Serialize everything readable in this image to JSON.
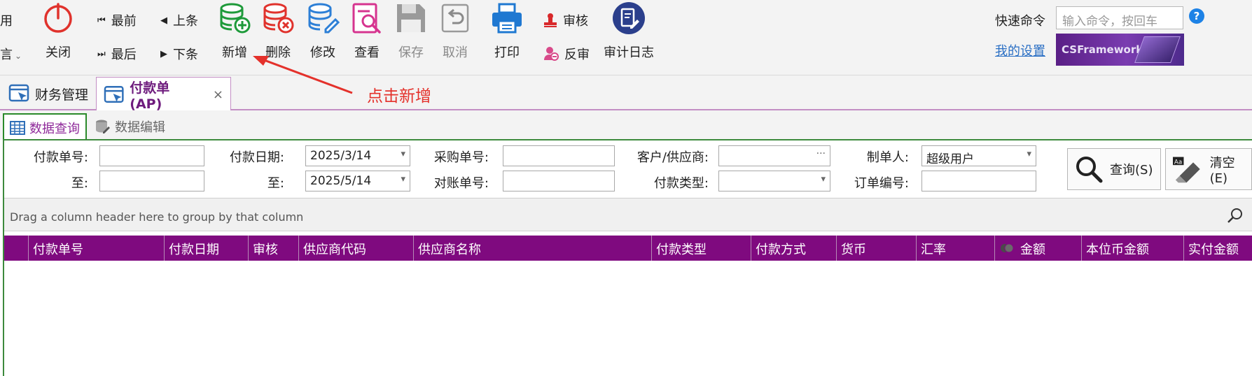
{
  "ribbon": {
    "left_cut_top": "用",
    "left_cut_bottom": "言",
    "close_label": "关闭",
    "nav": {
      "first": "最前",
      "prev": "上条",
      "last": "最后",
      "next": "下条"
    },
    "buttons": {
      "add": "新增",
      "delete": "删除",
      "edit": "修改",
      "view": "查看",
      "save": "保存",
      "cancel": "取消",
      "print": "打印",
      "approve": "审核",
      "unapprove": "反审",
      "audit_log": "审计日志"
    },
    "quick_command_label": "快速命令",
    "quick_command_placeholder": "输入命令，按回车",
    "help": "?",
    "my_settings": "我的设置",
    "brand": "CSFramework"
  },
  "annotation": {
    "text": "点击新增"
  },
  "tabs": [
    {
      "label": "财务管理"
    },
    {
      "label": "付款单(AP)"
    }
  ],
  "subtabs": [
    {
      "label": "数据查询"
    },
    {
      "label": "数据编辑"
    }
  ],
  "filter": {
    "payment_no": "付款单号:",
    "to1": "至:",
    "payment_date": "付款日期:",
    "to2": "至:",
    "date_from": "2025/3/14",
    "date_to": "2025/5/14",
    "purchase_no": "采购单号:",
    "reconcile_no": "对账单号:",
    "customer_supplier": "客户/供应商:",
    "payment_type": "付款类型:",
    "creator": "制单人:",
    "creator_value": "超级用户",
    "order_no": "订单编号:",
    "query_btn": "查询(S)",
    "clear_btn": "清空(E)"
  },
  "grid": {
    "group_hint": "Drag a column header here to group by that column",
    "columns": [
      "付款单号",
      "付款日期",
      "审核",
      "供应商代码",
      "供应商名称",
      "付款类型",
      "付款方式",
      "货币",
      "汇率",
      "金额",
      "本位币金额",
      "实付金额"
    ]
  }
}
